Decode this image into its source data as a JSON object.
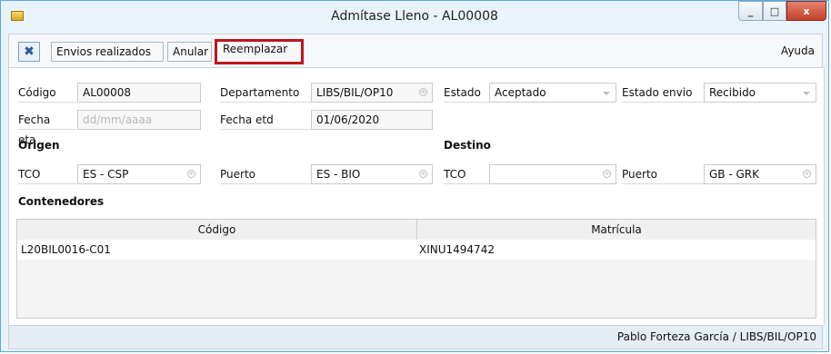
{
  "window": {
    "title": "Admítase Lleno - AL00008",
    "minimize_glyph": "_",
    "maximize_glyph": "□",
    "close_glyph": "x"
  },
  "toolbar": {
    "close_glyph": "✖",
    "envios_label": "Envios realizados",
    "anular_label": "Anular",
    "reemplazar_label": "Reemplazar",
    "ayuda_label": "Ayuda"
  },
  "form": {
    "codigo_label": "Código",
    "codigo_value": "AL00008",
    "departamento_label": "Departamento",
    "departamento_value": "LIBS/BIL/OP10",
    "estado_label": "Estado",
    "estado_value": "Aceptado",
    "estado_envio_label": "Estado envio",
    "estado_envio_value": "Recibido",
    "fecha_eta_label": "Fecha eta",
    "fecha_eta_placeholder": "dd/mm/aaaa",
    "fecha_etd_label": "Fecha etd",
    "fecha_etd_value": "01/06/2020"
  },
  "origen": {
    "section_label": "Origen",
    "tco_label": "TCO",
    "tco_value": "ES - CSP",
    "puerto_label": "Puerto",
    "puerto_value": "ES - BIO"
  },
  "destino": {
    "section_label": "Destino",
    "tco_label": "TCO",
    "tco_value": "",
    "puerto_label": "Puerto",
    "puerto_value": "GB - GRK"
  },
  "contenedores": {
    "section_label": "Contenedores",
    "columns": [
      "Código",
      "Matrícula"
    ],
    "rows": [
      [
        "L20BIL0016-C01",
        "XINU1494742"
      ]
    ]
  },
  "status": {
    "user": "Pablo Forteza García / LIBS/BIL/OP10"
  },
  "colors": {
    "window_bg": "#e9f3fb",
    "highlight_border": "#c0151a",
    "close_button": "#c4402a"
  }
}
